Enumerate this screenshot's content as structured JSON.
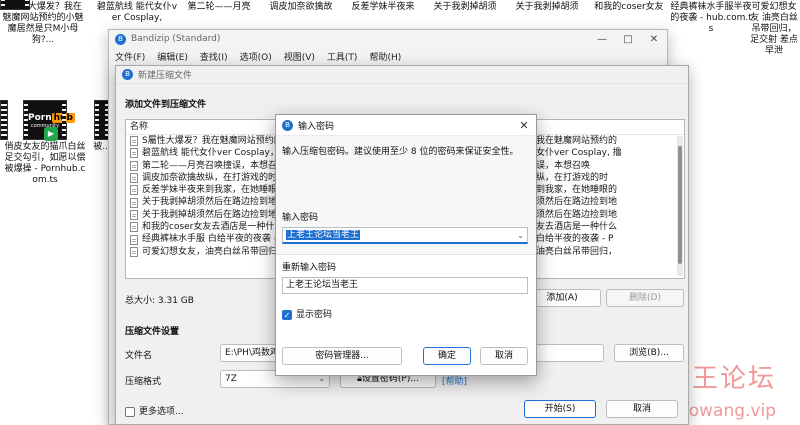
{
  "desktop": {
    "top_row": [
      {
        "label": "S屬性大爆发？我在魅魔网站预约的小魅魔居然是只M小母狗?..."
      },
      {
        "label": "碧蓝航线 能代女仆ver Cosplay,"
      },
      {
        "label": "第二轮——月亮"
      },
      {
        "label": "调皮加奈欲擒故"
      },
      {
        "label": "反差学妹半夜来"
      },
      {
        "label": "关于我剥掉胡须"
      },
      {
        "label": "关于我剥掉胡须"
      },
      {
        "label": "和我的coser女友"
      },
      {
        "label": "经典裤袜水手服半夜的夜袭 - hub.com.ts"
      },
      {
        "label": "可爱幻想女友 油亮白丝吊带回归，足交射 差点早泄"
      }
    ],
    "second_row": [
      {
        "label": "俏皮女友的猫爪白丝足交勾引，如愿以偿被爆操 - Pornhub.com.ts",
        "logo_text": "Porn",
        "logo_hub": "hub",
        "logo_sub": "community"
      },
      {
        "label": "被...",
        "logo_text": "Porn",
        "logo_hub": "hub",
        "logo_sub": "community"
      }
    ],
    "watermark": "老王论坛",
    "watermark_url": "laowang.vip"
  },
  "bandizip": {
    "title": "Bandizip (Standard)",
    "menus": [
      "文件(F)",
      "编辑(E)",
      "查找(I)",
      "选项(O)",
      "视图(V)",
      "工具(T)",
      "帮助(H)"
    ],
    "win_minimize": "—",
    "win_maximize": "□",
    "win_close": "✕"
  },
  "new_archive": {
    "title": "新建压缩文件",
    "add_section": "添加文件到压缩文件",
    "column_name": "名称",
    "files": [
      {
        "name": "S屬性大爆发？我在魅魔网站预约的",
        "name_right": "我在魅魔网站预约的"
      },
      {
        "name": "碧蓝航线 能代女仆ver Cosplay，",
        "name_right": "女仆ver Cosplay, 撸"
      },
      {
        "name": "第二轮——月亮召唤撞误，本想召",
        "name_right": "误，本想召唤"
      },
      {
        "name": "调皮加奈欲擒故纵，在打游戏的时",
        "name_right": "纵，在打游戏的时"
      },
      {
        "name": "反差学妹半夜来到我家，在她睡眼",
        "name_right": "到我家，在她睡眼的"
      },
      {
        "name": "关于我剥掉胡须然后在路边捡到地",
        "name_right": "须然后在路边捡到地"
      },
      {
        "name": "关于我剥掉胡须然后在路边捡到地",
        "name_right": "须然后在路边捡到地"
      },
      {
        "name": "和我的coser女友去酒店是一种什么",
        "name_right": "友去酒店是一种什么"
      },
      {
        "name": "经典裤袜水手服 白给半夜的夜袭 -",
        "name_right": "白给半夜的夜袭 - P"
      },
      {
        "name": "可爱幻想女友，油亮白丝吊带回归，",
        "name_right": "油亮白丝吊带回归，"
      }
    ],
    "total_size": "总大小: 3.31 GB",
    "add_button": "添加(A)",
    "delete_button": "删除(D)",
    "settings_section": "压缩文件设置",
    "filename_label": "文件名",
    "filename_value": "E:\\PH\\鸡数鸡",
    "browse_button": "浏览(B)...",
    "format_label": "压缩格式",
    "format_value": "7Z",
    "set_password_button": "设置密码(P)...",
    "help_link": "[帮助]",
    "more_options": "更多选项...",
    "start_button": "开始(S)",
    "cancel_button": "取消"
  },
  "password_dialog": {
    "title": "输入密码",
    "description": "输入压缩包密码。建议使用至少 8 位的密码来保证安全性。",
    "password_label": "输入密码",
    "password_value": "上老王论坛当老王",
    "confirm_label": "重新输入密码",
    "confirm_value": "上老王论坛当老王",
    "show_password": "显示密码",
    "manager_button": "密码管理器...",
    "ok_button": "确定",
    "cancel_button": "取消",
    "close": "✕"
  },
  "colors": {
    "accent": "#1f6fd1",
    "watermark": "#e64646",
    "badge": "#22a84a"
  }
}
